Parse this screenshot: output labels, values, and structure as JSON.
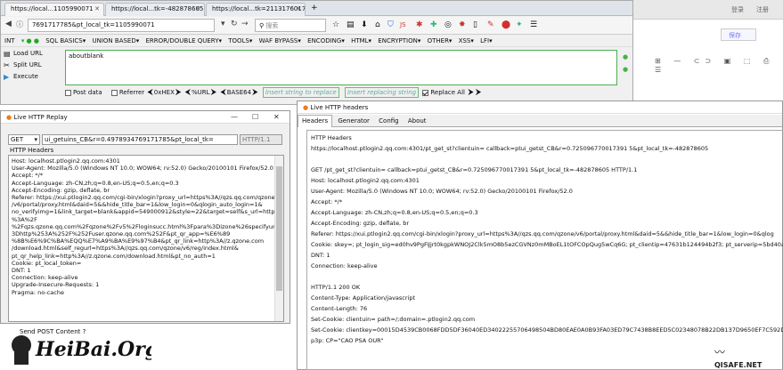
{
  "firefox": {
    "tabs": [
      {
        "title": "https://local...1105990071"
      },
      {
        "title": "https://local...tk=-482878605"
      },
      {
        "title": "https://local...tk=2113176017"
      }
    ],
    "new_tab": "+",
    "url": "7691717785&pt_local_tk=1105990071",
    "search_placeholder": "搜索",
    "hackbar_menu": [
      "INT",
      "SQL BASICS▾",
      "UNION BASED▾",
      "ERROR/DOUBLE QUERY▾",
      "TOOLS▾",
      "WAF BYPASS▾",
      "ENCODING▾",
      "HTML▾",
      "ENCRYPTION▾",
      "OTHER▾",
      "XSS▾",
      "LFI▾"
    ],
    "load_url": "Load URL",
    "split_url": "Split URL",
    "execute": "Execute",
    "hackbar_value": "aboutblank",
    "post_data": "Post data",
    "referrer": "Referrer",
    "hex_label": "0xHEX",
    "url_label": "%URL",
    "base64_label": "BASE64",
    "insert_placeholder": "Insert string to replace",
    "replace_placeholder": "Insert replacing string",
    "replace_all": "Replace All"
  },
  "right_strip": {
    "top_labels": [
      "登录",
      "注册"
    ],
    "button": "保存"
  },
  "replay": {
    "title": "Live HTTP Replay",
    "method": "GET",
    "url": "ui_getuins_CB&r=0.4978934769171785&pt_local_tk=",
    "version": "HTTP/1.1",
    "headers_label": "HTTP Headers",
    "lines": [
      "Host: localhost.ptlogin2.qq.com:4301",
      "User-Agent: Mozilla/5.0 (Windows NT 10.0; WOW64; rv:52.0) Gecko/20100101 Firefox/52.0",
      "Accept: */*",
      "Accept-Language: zh-CN,zh;q=0.8,en-US;q=0.5,en;q=0.3",
      "Accept-Encoding: gzip, deflate, br",
      "Referer: https://xui.ptlogin2.qq.com/cgi-bin/xlogin?proxy_url=https%3A//qzs.qq.com/qzone",
      "/v6/portal/proxy.html&daid=5&&hide_title_bar=1&low_login=0&qlogin_auto_login=1&",
      "no_verifyimg=1&link_target=blank&appid=549000912&style=22&target=self&s_url=https",
      "%3A%2F",
      "%2Fqzs.qzone.qq.com%2Fqzone%2Fv5%2Floginsucc.html%3Fpara%3Dizone%26specifyurl%",
      "3Dhttp%253A%252F%252Fuser.qzone.qq.com%252F&pt_qr_app=%E6%89",
      "%8B%E6%9C%BA%EQQ%E7%A9%BA%E9%97%B4&pt_qr_link=http%3A//z.qzone.com",
      "/download.html&self_regurl=https%3A//qzs.qq.com/qzone/v6/reg/index.html&",
      "pt_qr_help_link=http%3A//z.qzone.com/download.html&pt_no_auth=1",
      "Cookie: pt_local_token=",
      "DNT: 1",
      "Connection: keep-alive",
      "Upgrade-Insecure-Requests: 1",
      "Pragma: no-cache"
    ],
    "sniff": "Send POST Content ?"
  },
  "headers": {
    "title": "Live HTTP headers",
    "tabs": [
      "Headers",
      "Generator",
      "Config",
      "About"
    ],
    "section": "HTTP Headers",
    "lines": [
      "https://localhost.ptlogin2.qq.com:4301/pt_get_st?clientuin=          callback=ptui_getst_CB&r=0.725096770017391 5&pt_local_tk=-482878605",
      "",
      "GET /pt_get_st?clientuin=          callback=ptui_getst_CB&r=0.725096770017391 5&pt_local_tk=-482878605 HTTP/1.1",
      "Host: localhost.ptlogin2.qq.com:4301",
      "User-Agent: Mozilla/5.0 (Windows NT 10.0; WOW64; rv:52.0) Gecko/20100101 Firefox/52.0",
      "Accept: */*",
      "Accept-Language: zh-CN,zh;q=0.8,en-US;q=0.5,en;q=0.3",
      "Accept-Encoding: gzip, deflate, br",
      "Referer: https://xui.ptlogin2.qq.com/cgi-bin/xlogin?proxy_url=https%3A//qzs.qq.com/qzone/v6/portal/proxy.html&daid=5&&hide_title_bar=1&low_login=0&qlog",
      "Cookie: skey=; pt_login_sig=ed0hv9PgFiJjrt0kgpkWNOJ2Clk5mO8b5ezCGVNz0mMBoEL1tOFCOpQug5wCq6G; pt_clientip=47631b124494b2f3; pt_serverip=5bd40a",
      "DNT: 1",
      "Connection: keep-alive",
      "",
      "HTTP/1.1 200 OK",
      "Content-Type: Application/javascript",
      "Content-Length: 76",
      "Set-Cookie: clientuin=          path=/;domain=.ptlogin2.qq.com",
      "Set-Cookie: clientkey=00015D4539CB0068FDD5DF36040ED34022255706498504BD80EAE0A0B93FA03ED79C7438B8EED5C02348078B22DB137D9650EF7C592D1",
      "p3p: CP=\"CAO PSA OUR\""
    ]
  },
  "logo_text": "HeiBai.Org",
  "watermark_text": "QISAFE.NET",
  "colors": {
    "accent_green": "#4caf50",
    "red_icon": "#d32f2f"
  }
}
